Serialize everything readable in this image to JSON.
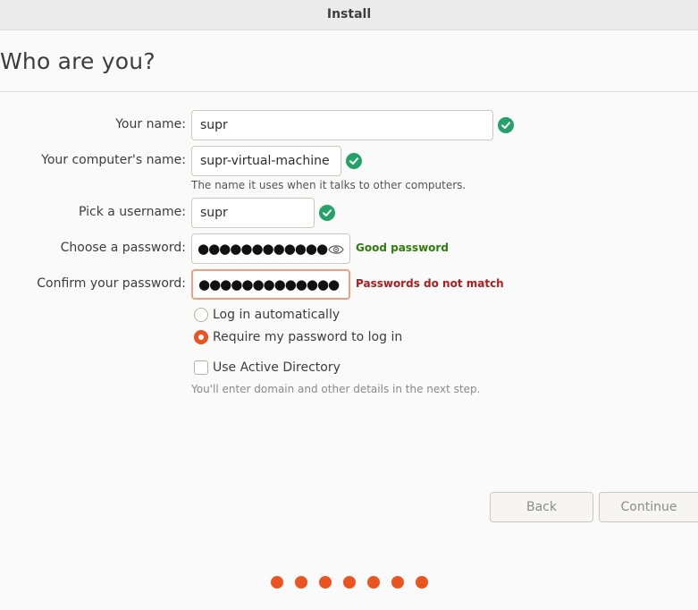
{
  "window": {
    "title": "Install"
  },
  "page": {
    "title": "Who are you?"
  },
  "form": {
    "name": {
      "label": "Your name:",
      "value": "supr",
      "valid": true
    },
    "computer_name": {
      "label": "Your computer's name:",
      "value": "supr-virtual-machine",
      "hint": "The name it uses when it talks to other computers.",
      "valid": true
    },
    "username": {
      "label": "Pick a username:",
      "value": "supr",
      "valid": true
    },
    "password": {
      "label": "Choose a password:",
      "masked": "●●●●●●●●●●●●",
      "strength": "Good password"
    },
    "confirm_password": {
      "label": "Confirm your password:",
      "masked": "●●●●●●●●●●●●●",
      "error": "Passwords do not match"
    },
    "login_options": [
      {
        "label": "Log in automatically",
        "selected": false
      },
      {
        "label": "Require my password to log in",
        "selected": true
      }
    ],
    "active_directory": {
      "label": "Use Active Directory",
      "checked": false,
      "hint": "You'll enter domain and other details in the next step."
    }
  },
  "buttons": {
    "back": "Back",
    "continue": "Continue"
  },
  "progress": {
    "total_steps": 7
  },
  "colors": {
    "accent": "#e95420",
    "valid": "#26a269",
    "good": "#2e7d0b",
    "error": "#b01c1c"
  },
  "icons": {
    "valid": "check-circle-icon",
    "reveal": "eye-icon"
  }
}
